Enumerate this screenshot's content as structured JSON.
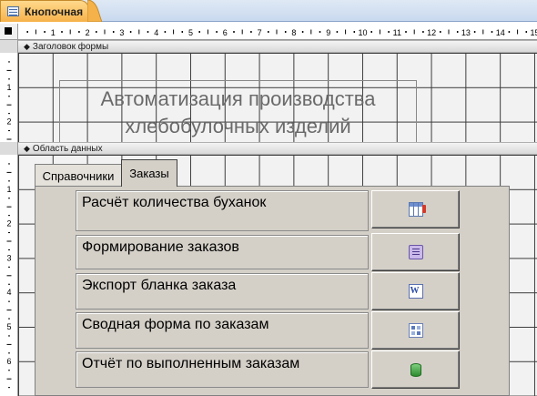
{
  "document_tab": {
    "label": "Кнопочная",
    "icon": "form-icon"
  },
  "rulers": {
    "horizontal_ticks": [
      "1",
      "2",
      "3",
      "4",
      "5",
      "6",
      "7",
      "8",
      "9",
      "10",
      "11",
      "12",
      "13",
      "14",
      "15"
    ],
    "vertical_ticks": [
      "1",
      "2",
      "1",
      "2",
      "3",
      "4",
      "5",
      "6"
    ]
  },
  "sections": {
    "header": "Заголовок формы",
    "detail": "Область данных"
  },
  "form_title": {
    "line1": "Автоматизация производства",
    "line2": "хлебобулочных изделий"
  },
  "tab_control": {
    "tabs": [
      {
        "label": "Справочники"
      },
      {
        "label": "Заказы"
      }
    ],
    "active_tab": "Заказы"
  },
  "actions": [
    {
      "label": "Расчёт количества буханок",
      "icon": "table-calc-icon"
    },
    {
      "label": "Формирование заказов",
      "icon": "form-icon"
    },
    {
      "label": "Экспорт бланка заказа",
      "icon": "word-export-icon"
    },
    {
      "label": "Сводная форма по заказам",
      "icon": "summary-form-icon"
    },
    {
      "label": "Отчёт по выполненным заказам",
      "icon": "database-report-icon"
    }
  ]
}
